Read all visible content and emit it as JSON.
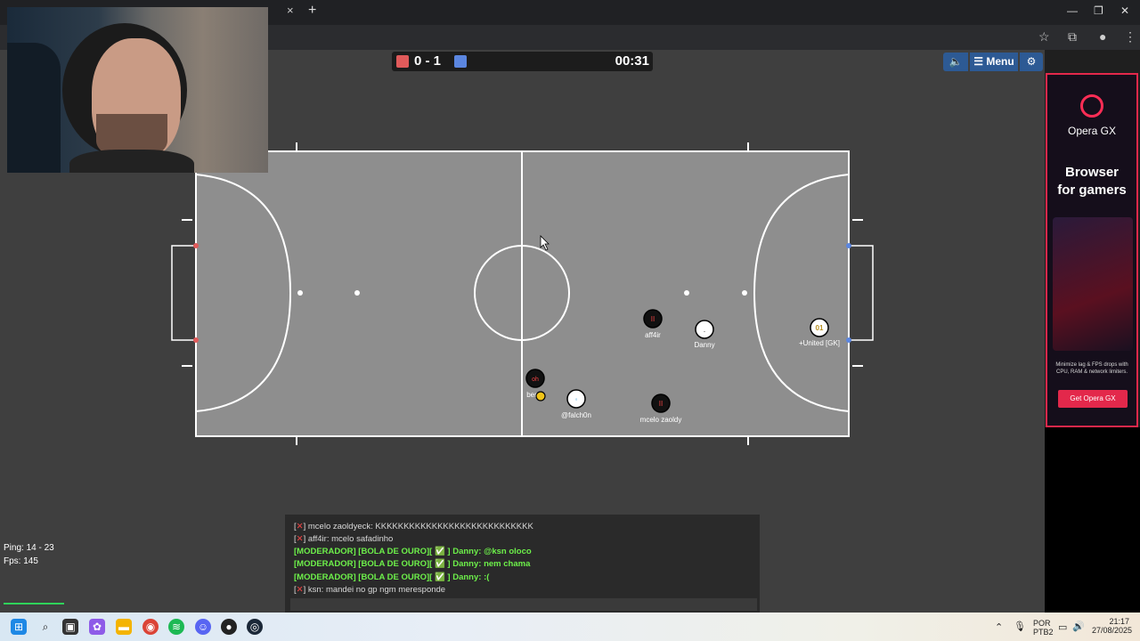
{
  "browser": {
    "tab_close": "×",
    "new_tab": "+",
    "window_controls": [
      "—",
      "❐",
      "✕"
    ]
  },
  "scoreboard": {
    "score": "0 - 1",
    "timer": "00:31",
    "red_color": "#e05a5a",
    "blue_color": "#5b86e0"
  },
  "menu": {
    "label": "Menu"
  },
  "players": [
    {
      "name": "aff4ir",
      "team": "dark",
      "avatar": "II"
    },
    {
      "name": "Danny",
      "team": "white",
      "avatar": "."
    },
    {
      "name": "+United [GK]",
      "team": "white",
      "avatar": "01"
    },
    {
      "name": "ber",
      "team": "dark",
      "avatar": "oh"
    },
    {
      "name": "@falch0n",
      "team": "white",
      "avatar": "◦"
    },
    {
      "name": "mcelo zaoldy",
      "team": "dark",
      "avatar": "II"
    }
  ],
  "chat": [
    {
      "prefix": "[",
      "x": "✕",
      "suffix": "] mcelo zaoldyeck: KKKKKKKKKKKKKKKKKKKKKKKKKKKK",
      "type": "normal"
    },
    {
      "prefix": "[",
      "x": "✕",
      "suffix": "] aff4ir: mcelo safadinho",
      "type": "normal"
    },
    {
      "text": "[MODERADOR] [BOLA DE OURO][ ✅ ] Danny: @ksn oloco",
      "type": "mod"
    },
    {
      "text": "[MODERADOR] [BOLA DE OURO][ ✅ ] Danny: nem chama",
      "type": "mod"
    },
    {
      "text": "[MODERADOR] [BOLA DE OURO][ ✅ ] Danny: :(",
      "type": "mod"
    },
    {
      "prefix": "[",
      "x": "✕",
      "suffix": "] ksn: mandei no gp ngm meresponde",
      "type": "normal"
    }
  ],
  "stats": {
    "ping": "Ping: 14 - 23",
    "fps": "Fps: 145"
  },
  "ad": {
    "brand": "Opera GX",
    "headline_line1": "Browser",
    "headline_line2": "for gamers",
    "subtext": "Minimize lag & FPS drops with CPU, RAM & network limiters.",
    "cta": "Get Opera GX"
  },
  "taskbar": {
    "lang1": "POR",
    "lang2": "PTB2",
    "time": "21:17",
    "date": "27/08/2025"
  },
  "colors": {
    "field": "#8e8e8e",
    "red_goal": "#e05a5a",
    "blue_goal": "#5b86e0",
    "chat_mod": "#6df04a",
    "ad_accent": "#e3284b"
  }
}
